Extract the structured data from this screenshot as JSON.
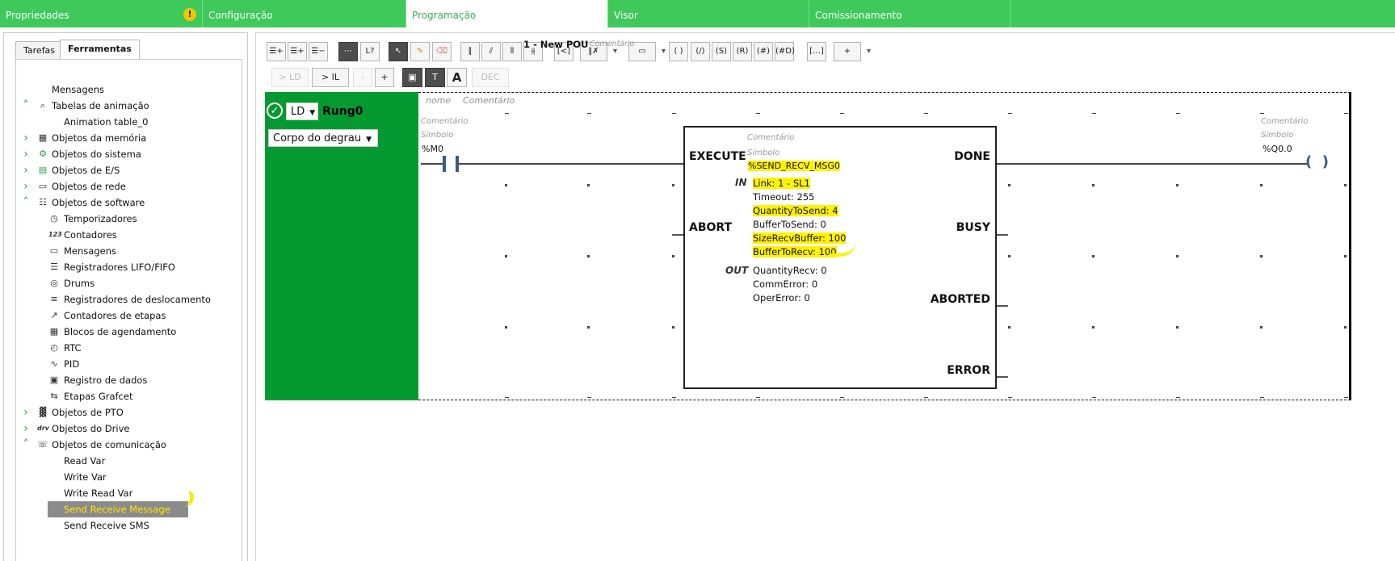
{
  "top_tabs": [
    {
      "label": "Propriedades",
      "warning": "!"
    },
    {
      "label": "Configuração"
    },
    {
      "label": "Programação"
    },
    {
      "label": "Visor"
    },
    {
      "label": "Comissionamento"
    }
  ],
  "left_tabs": [
    "Tarefas",
    "Ferramentas"
  ],
  "tree": [
    {
      "label": "Mensagens",
      "arrow": "",
      "icon": ""
    },
    {
      "label": "Tabelas de animação",
      "arrow": "^",
      "icon": "animation-table-icon"
    },
    {
      "label": "Animation table_0",
      "arrow": "",
      "icon": ""
    },
    {
      "label": "Objetos da memória",
      "arrow": ">",
      "icon": "memory-icon"
    },
    {
      "label": "Objetos do sistema",
      "arrow": ">",
      "icon": "system-gear-icon"
    },
    {
      "label": "Objetos de E/S",
      "arrow": ">",
      "icon": "io-grid-icon"
    },
    {
      "label": "Objetos de rede",
      "arrow": ">",
      "icon": "network-icon"
    },
    {
      "label": "Objetos de software",
      "arrow": "^",
      "icon": "software-icon"
    },
    {
      "label": "Temporizadores",
      "arrow": "",
      "icon": "timer-icon"
    },
    {
      "label": "Contadores",
      "arrow": "",
      "icon": "counter-icon"
    },
    {
      "label": "Mensagens",
      "arrow": "",
      "icon": "message-icon"
    },
    {
      "label": "Registradores LIFO/FIFO",
      "arrow": "",
      "icon": "lifo-fifo-icon"
    },
    {
      "label": "Drums",
      "arrow": "",
      "icon": "drum-icon"
    },
    {
      "label": "Registradores de deslocamento",
      "arrow": "",
      "icon": "shift-register-icon"
    },
    {
      "label": "Contadores de etapas",
      "arrow": "",
      "icon": "step-counter-icon"
    },
    {
      "label": "Blocos de agendamento",
      "arrow": "",
      "icon": "calendar-icon"
    },
    {
      "label": "RTC",
      "arrow": "",
      "icon": "clock-icon"
    },
    {
      "label": "PID",
      "arrow": "",
      "icon": "pid-icon"
    },
    {
      "label": "Registro de dados",
      "arrow": "",
      "icon": "data-log-icon"
    },
    {
      "label": "Etapas Grafcet",
      "arrow": "",
      "icon": "grafcet-icon"
    },
    {
      "label": "Objetos de PTO",
      "arrow": ">",
      "icon": "pto-icon"
    },
    {
      "label": "Objetos do Drive",
      "arrow": ">",
      "icon": "drive-icon"
    },
    {
      "label": "Objetos de comunicação",
      "arrow": "^",
      "icon": "communication-icon"
    },
    {
      "label": "Read Var",
      "arrow": "",
      "icon": ""
    },
    {
      "label": "Write Var",
      "arrow": "",
      "icon": ""
    },
    {
      "label": "Write Read Var",
      "arrow": "",
      "icon": ""
    },
    {
      "label": "Send Receive Message",
      "arrow": "",
      "icon": "",
      "selected": true
    },
    {
      "label": "Send Receive SMS",
      "arrow": "",
      "icon": ""
    }
  ],
  "toolbar2": {
    "to_ld": "> LD",
    "to_il": "> IL",
    "minus": "-",
    "plus": "+",
    "dec": "DEC",
    "pou_title": "1 - New POU",
    "pou_comment": "Comentário"
  },
  "rung": {
    "lang": "LD",
    "name": "Rung0",
    "body_select": "Corpo do degrau",
    "name_placeholder": "nome",
    "comment_placeholder": "Comentário",
    "contact": {
      "comment": "Comentário",
      "symbol": "Símbolo",
      "address": "%M0"
    },
    "coil": {
      "comment": "Comentário",
      "symbol": "Símbolo",
      "address": "%Q0.0"
    }
  },
  "function_block": {
    "comment": "Comentário",
    "symbol": "Símbolo",
    "instance": "%SEND_RECV_MSG0",
    "inputs_left": [
      "EXECUTE",
      "ABORT"
    ],
    "outputs_right": [
      "DONE",
      "BUSY",
      "ABORTED",
      "ERROR"
    ],
    "in_label": "IN",
    "out_label": "OUT",
    "in_params": [
      "Link: 1 - SL1",
      "Timeout: 255",
      "QuantityToSend: 4",
      "BufferToSend: 0",
      "SizeRecvBuffer: 100",
      "BufferToRecv: 100"
    ],
    "out_params": [
      "QuantityRecv: 0",
      "CommError: 0",
      "OperError: 0"
    ]
  },
  "colors": {
    "accent_green": "#3ec95a",
    "rung_green": "#049a31",
    "highlight": "#fff200"
  }
}
